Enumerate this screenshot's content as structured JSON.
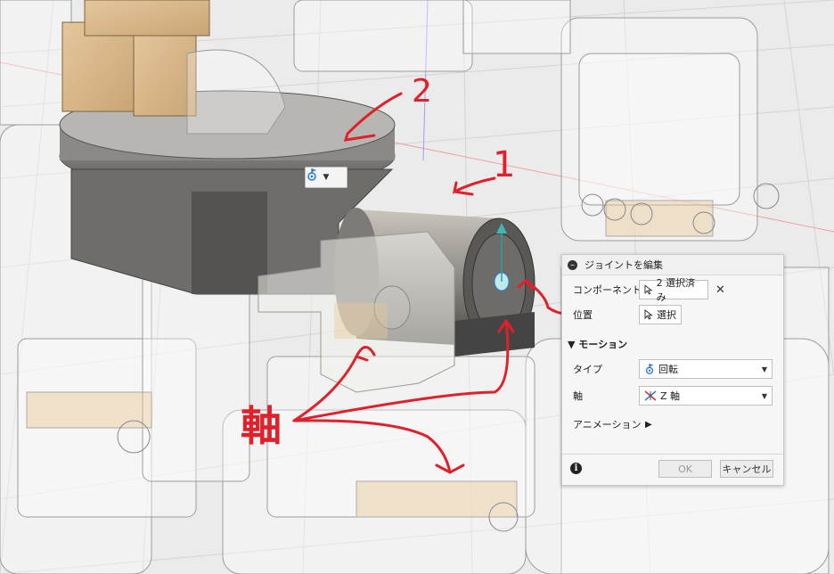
{
  "dialog": {
    "title": "ジョイントを編集",
    "component_label": "コンポーネント",
    "component_value": "2 選択済み",
    "position_label": "位置",
    "position_value": "選択",
    "motion_section": "モーション",
    "type_label": "タイプ",
    "type_value": "回転",
    "axis_label": "軸",
    "axis_value": "Z 軸",
    "animation_label": "アニメーション",
    "ok_label": "OK",
    "cancel_label": "キャンセル"
  },
  "annotations": {
    "num1": "1",
    "num2": "2",
    "axis_kanji": "軸"
  },
  "colors": {
    "annotation": "#e0202a",
    "joint_accent": "#2a7fd4"
  },
  "icons": [
    "joint-icon",
    "cursor-icon",
    "close-icon",
    "revolute-icon",
    "axis-icon",
    "play-icon",
    "info-icon",
    "minus-icon"
  ]
}
